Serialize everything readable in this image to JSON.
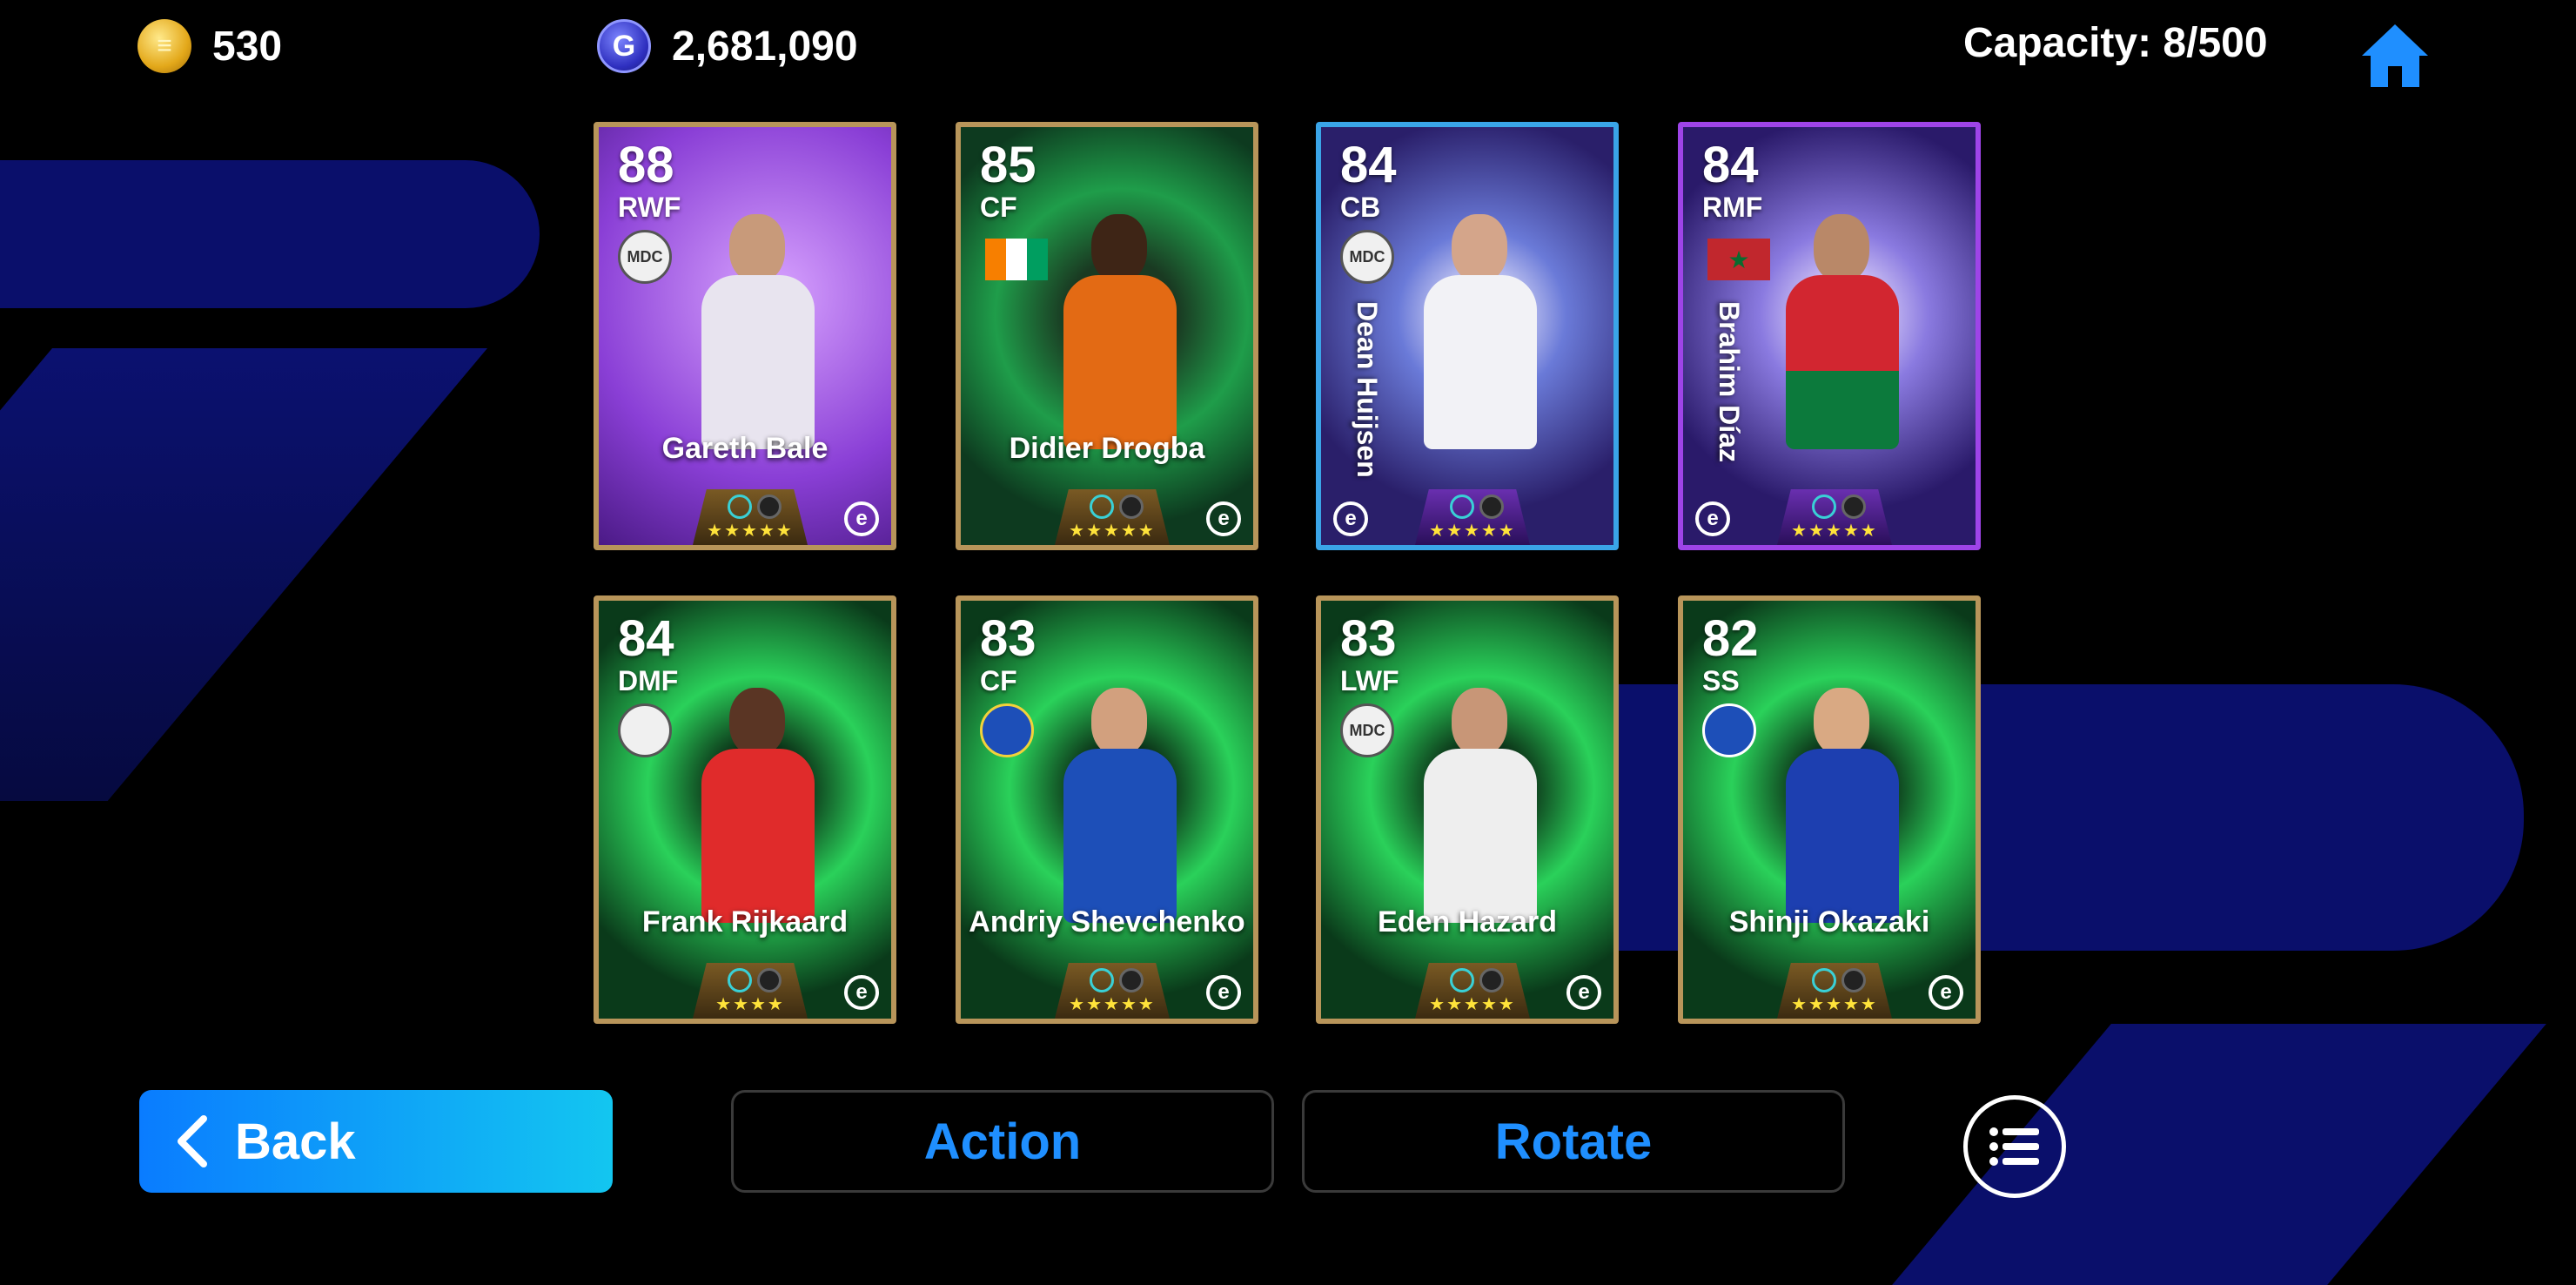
{
  "currency": {
    "coins_value": "530",
    "gp_value": "2,681,090"
  },
  "capacity_text": "Capacity: 8/500",
  "cards": [
    {
      "rating": "88",
      "position": "RWF",
      "name": "Gareth Bale",
      "badge": "MDC"
    },
    {
      "rating": "85",
      "position": "CF",
      "name": "Didier Drogba",
      "badge": ""
    },
    {
      "rating": "84",
      "position": "CB",
      "name": "Dean Huijsen",
      "badge": "MDC"
    },
    {
      "rating": "84",
      "position": "RMF",
      "name": "Brahim Díaz",
      "badge": ""
    },
    {
      "rating": "84",
      "position": "DMF",
      "name": "Frank Rijkaard",
      "badge": ""
    },
    {
      "rating": "83",
      "position": "CF",
      "name": "Andriy Shevchenko",
      "badge": ""
    },
    {
      "rating": "83",
      "position": "LWF",
      "name": "Eden Hazard",
      "badge": "MDC"
    },
    {
      "rating": "82",
      "position": "SS",
      "name": "Shinji Okazaki",
      "badge": ""
    }
  ],
  "buttons": {
    "back_label": "Back",
    "action_label": "Action",
    "rotate_label": "Rotate"
  },
  "icons": {
    "coin": "coin-icon",
    "gp": "gp-icon",
    "home": "home-icon",
    "back": "chevron-left-icon",
    "list": "list-menu-icon"
  },
  "colors": {
    "accent_blue": "#1f8fff",
    "background": "#000000",
    "bg_shape": "#0a0f6b"
  }
}
